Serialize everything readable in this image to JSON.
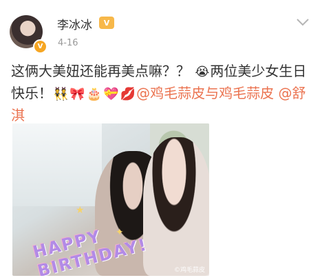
{
  "post": {
    "username": "李冰冰",
    "vip_label": "V",
    "time": "4-16",
    "text_parts": {
      "part1": "这俩大美妞还能再美点嘛？？",
      "part2": "两位美少女生日快乐！",
      "mention1": "@鸡毛蒜皮与鸡毛蒜皮",
      "mention2": "@舒淇"
    },
    "emojis": [
      "crying-face-icon",
      "dancing-girls-icon",
      "bow-icon",
      "cake-icon",
      "gift-heart-icon",
      "kiss-lips-icon"
    ],
    "image": {
      "overlay_text": "HAPPY BIRTHDAY!",
      "watermark": "©鸡毛蒜皮"
    }
  },
  "colors": {
    "link": "#eb7350",
    "text": "#333333",
    "meta": "#999999",
    "vip": "#f6a623"
  }
}
